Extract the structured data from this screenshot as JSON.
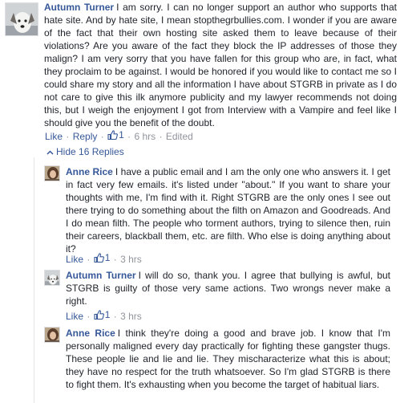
{
  "comments": [
    {
      "author": "Autumn Turner",
      "text": "I am sorry. I can no longer support an author who supports that hate site. And by hate site, I mean stopthegrbullies.com. I wonder if you are aware of the fact that their own hosting site asked them to leave because of their violations? Are you aware of the fact they block the IP addresses of those they malign? I am very sorry that you have fallen for this group who are, in fact, what they proclaim to be against. I would be honored if you would like to contact me so I could share my story and all the information I have about STGRB in private as I do not care to give this ilk anymore publicity and my lawyer recommends not doing this, but I weigh the enjoyment I got from Interview with a Vampire and feel like I should give you the benefit of the doubt.",
      "like_label": "Like",
      "reply_label": "Reply",
      "likes": "1",
      "time": "6 hrs",
      "edited": "Edited"
    }
  ],
  "hide_replies_label": "Hide 16 Replies",
  "replies": [
    {
      "author": "Anne Rice",
      "text": "I have a public email and I am the only one who answers it. I get in fact very few emails. it's listed under \"about.\" If you want to share your thoughts with me, I'm find with it. Right STGRB are the only ones I see out there trying to do something about the filth on Amazon and Goodreads. And I do mean filth. The people who torment authors, trying to silence then, ruin their careers, blackball them, etc. are filth. Who else is doing anything about it?",
      "like_label": "Like",
      "likes": "1",
      "time": "3 hrs"
    },
    {
      "author": "Autumn Turner",
      "text": "I will do so, thank you. I agree that bullying is awful, but STGRB is guilty of those very same actions. Two wrongs never make a right.",
      "like_label": "Like",
      "likes": "1",
      "time": "3 hrs"
    },
    {
      "author": "Anne Rice",
      "text": "I think they're doing a good and brave job. I know that I'm personally maligned every day practically for fighting these gangster thugs. These people lie and lie and lie. They mischaracterize what this is about; they have no respect for the truth whatsoever. So I'm glad STGRB is there to fight them. It's exhausting when you become the target of habitual liars."
    }
  ],
  "colors": {
    "link": "#365899",
    "text": "#1d2129",
    "muted": "#90949c"
  },
  "icons": [
    "dog-avatar",
    "thumbs-up-icon",
    "chevron-up-icon",
    "woman-avatar"
  ]
}
